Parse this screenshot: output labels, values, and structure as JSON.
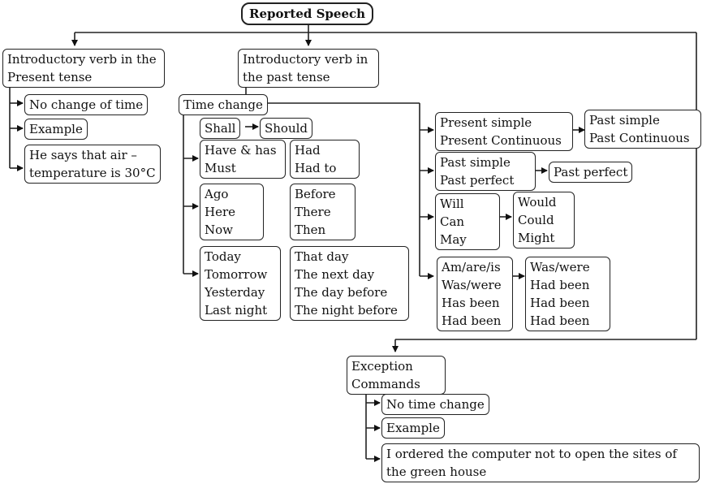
{
  "title": "Reported Speech",
  "present_branch": {
    "heading": [
      "Introductory verb in the",
      "Present tense"
    ],
    "items": [
      [
        "No change of time"
      ],
      [
        "Example"
      ],
      [
        "He says that air –",
        "temperature is 30°C"
      ]
    ]
  },
  "past_branch": {
    "heading": [
      "Introductory verb in",
      "the past tense"
    ],
    "time_change": "Time change",
    "time_pairs": [
      {
        "from": [
          "Shall"
        ],
        "to": [
          "Should"
        ]
      },
      {
        "from": [
          "Have & has",
          "Must"
        ],
        "to": [
          "Had",
          "Had to"
        ]
      },
      {
        "from": [
          "Ago",
          "Here",
          "Now"
        ],
        "to": [
          "Before",
          "There",
          "Then"
        ]
      },
      {
        "from": [
          "Today",
          "Tomorrow",
          "Yesterday",
          "Last night"
        ],
        "to": [
          "That day",
          "The next day",
          "The day before",
          "The night before"
        ]
      }
    ],
    "tense_pairs": [
      {
        "from": [
          "Present simple",
          "Present Continuous"
        ],
        "to": [
          "Past simple",
          "Past Continuous"
        ]
      },
      {
        "from": [
          "Past simple",
          "Past perfect"
        ],
        "to": [
          "Past perfect"
        ]
      },
      {
        "from": [
          "Will",
          "Can",
          "May"
        ],
        "to": [
          "Would",
          "Could",
          "Might"
        ]
      },
      {
        "from": [
          "Am/are/is",
          "Was/were",
          "Has been",
          "Had been"
        ],
        "to": [
          "Was/were",
          "Had been",
          "Had been",
          "Had been"
        ]
      }
    ]
  },
  "exception_branch": {
    "heading": [
      "Exception",
      "Commands"
    ],
    "items": [
      [
        "No time change"
      ],
      [
        "Example"
      ],
      [
        "I ordered the computer not to open the sites of",
        "the green house"
      ]
    ]
  }
}
